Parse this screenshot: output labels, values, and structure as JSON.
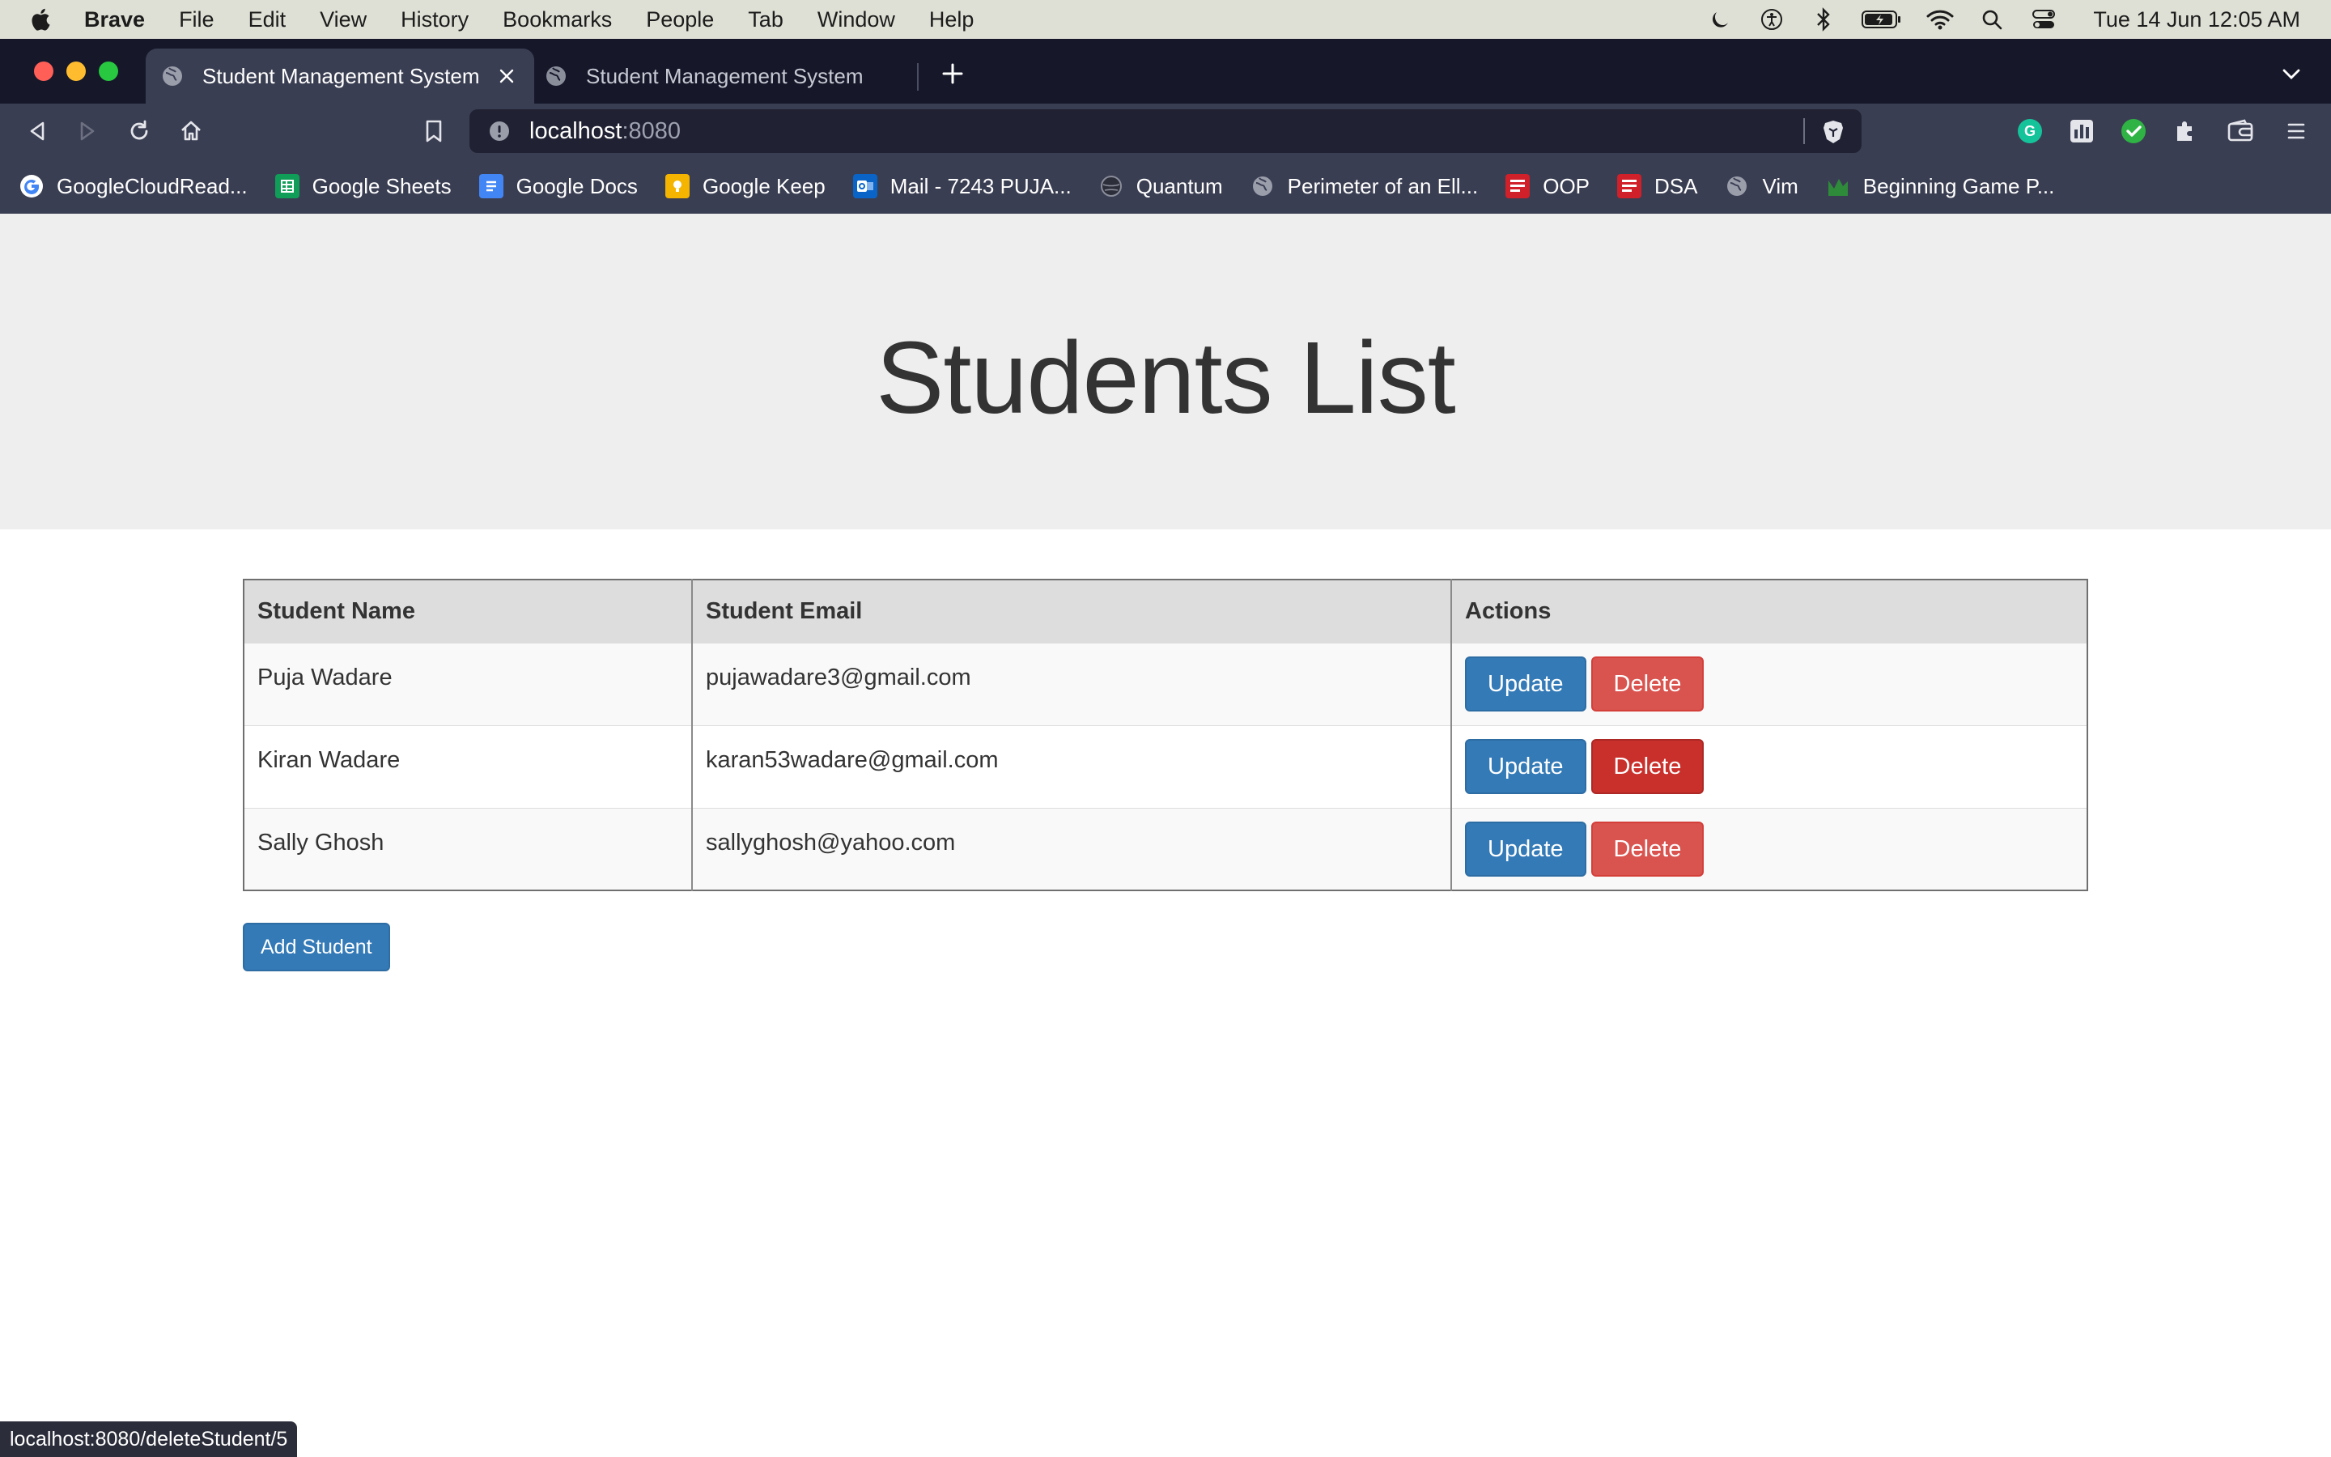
{
  "menubar": {
    "app_name": "Brave",
    "items": [
      "File",
      "Edit",
      "View",
      "History",
      "Bookmarks",
      "People",
      "Tab",
      "Window",
      "Help"
    ],
    "clock": "Tue 14 Jun  12:05 AM"
  },
  "tabs": [
    {
      "title": "Student Management System",
      "active": true
    },
    {
      "title": "Student Management System",
      "active": false
    }
  ],
  "omnibox": {
    "host": "localhost",
    "port": ":8080"
  },
  "bookmarks": [
    {
      "label": "GoogleCloudRead...",
      "icon": "google-icon"
    },
    {
      "label": "Google Sheets",
      "icon": "sheets-icon"
    },
    {
      "label": "Google Docs",
      "icon": "docs-icon"
    },
    {
      "label": "Google Keep",
      "icon": "keep-icon"
    },
    {
      "label": "Mail - 7243 PUJA...",
      "icon": "outlook-icon"
    },
    {
      "label": "Quantum",
      "icon": "globe-icon"
    },
    {
      "label": "Perimeter of an Ell...",
      "icon": "globe-icon"
    },
    {
      "label": "OOP",
      "icon": "mcgraw-icon"
    },
    {
      "label": "DSA",
      "icon": "mcgraw-icon"
    },
    {
      "label": "Vim",
      "icon": "globe-icon"
    },
    {
      "label": "Beginning Game P...",
      "icon": "chart-icon"
    }
  ],
  "page": {
    "title": "Students List",
    "table": {
      "headers": [
        "Student Name",
        "Student Email",
        "Actions"
      ],
      "rows": [
        {
          "name": "Puja Wadare",
          "email": "pujawadare3@gmail.com"
        },
        {
          "name": "Kiran Wadare",
          "email": "karan53wadare@gmail.com"
        },
        {
          "name": "Sally Ghosh",
          "email": "sallyghosh@yahoo.com"
        }
      ],
      "update_label": "Update",
      "delete_label": "Delete"
    },
    "add_button": "Add Student"
  },
  "status_url": "localhost:8080/deleteStudent/5",
  "colors": {
    "primary": "#337ab7",
    "danger": "#d9534f",
    "danger_hover": "#c9302c",
    "jumbotron": "#eeeeee",
    "browser_chrome": "#3a3e52"
  }
}
